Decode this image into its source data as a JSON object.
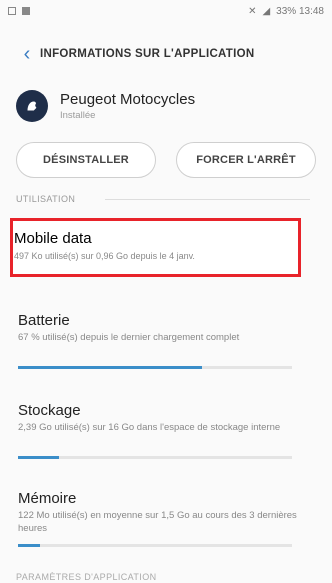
{
  "statusbar": {
    "right_text": "33% 13:48"
  },
  "header": {
    "title": "INFORMATIONS SUR L'APPLICATION"
  },
  "app": {
    "name": "Peugeot Motocycles",
    "status": "Installée"
  },
  "actions": {
    "uninstall_label": "DÉSINSTALLER",
    "force_stop_label": "FORCER L'ARRÊT"
  },
  "section": {
    "label": "UTILISATION"
  },
  "mobile_data": {
    "title": "Mobile data",
    "subtitle": "497 Ko utilisé(s) sur 0,96 Go depuis le 4 janv."
  },
  "items": [
    {
      "title": "Batterie",
      "subtitle": "67 % utilisé(s) depuis le dernier chargement complet",
      "progress": 0.67
    },
    {
      "title": "Stockage",
      "subtitle": "2,39 Go utilisé(s) sur 16 Go dans l'espace de stockage interne",
      "progress": 0.15
    },
    {
      "title": "Mémoire",
      "subtitle": "122 Mo utilisé(s) en moyenne sur 1,5 Go au cours des 3 dernières heures",
      "progress": 0.08
    }
  ],
  "footer": {
    "label": "PARAMÈTRES D'APPLICATION"
  }
}
